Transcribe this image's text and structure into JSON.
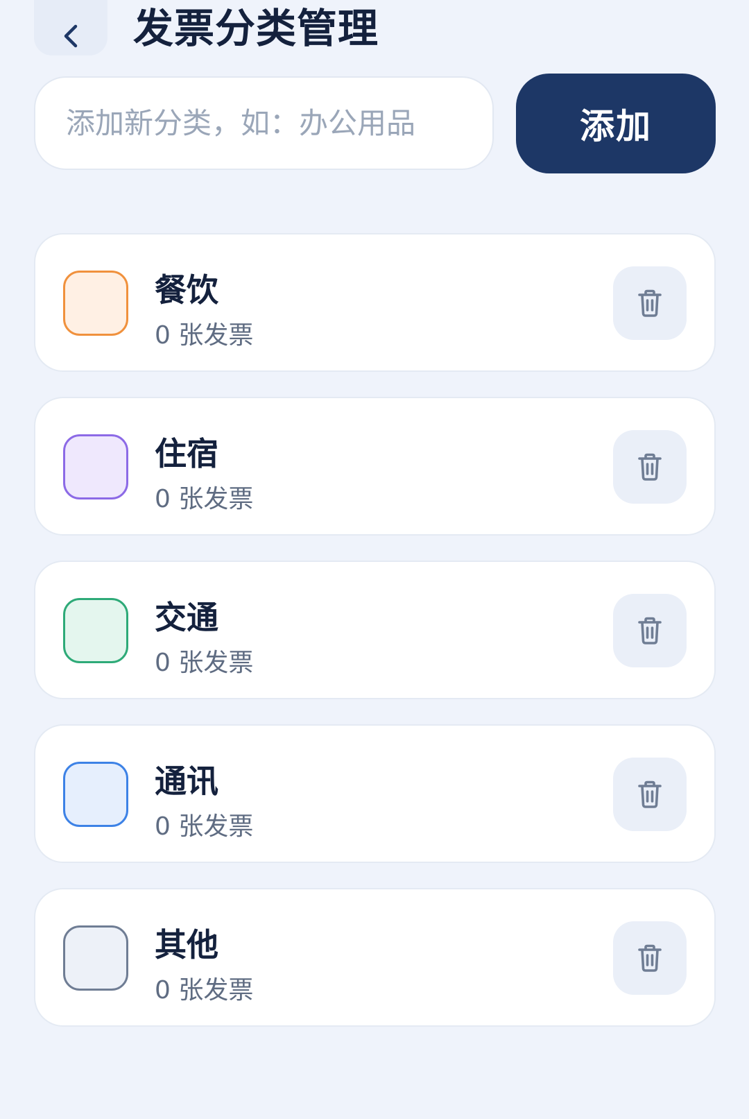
{
  "header": {
    "title": "发票分类管理",
    "back_icon": "chevron-left-icon"
  },
  "add_form": {
    "placeholder": "添加新分类，如：办公用品",
    "value": "",
    "button_label": "添加"
  },
  "categories": [
    {
      "name": "餐饮",
      "count_label": "0 张发票",
      "border": "#f0913d",
      "fill": "#fff0e4"
    },
    {
      "name": "住宿",
      "count_label": "0 张发票",
      "border": "#8c6ae6",
      "fill": "#efe8fd"
    },
    {
      "name": "交通",
      "count_label": "0 张发票",
      "border": "#2eaa78",
      "fill": "#e4f6ee"
    },
    {
      "name": "通讯",
      "count_label": "0 张发票",
      "border": "#3d82e6",
      "fill": "#e6effd"
    },
    {
      "name": "其他",
      "count_label": "0 张发票",
      "border": "#6f7d94",
      "fill": "#edf1f8"
    }
  ],
  "icons": {
    "delete": "trash-icon"
  },
  "colors": {
    "background": "#eff3fb",
    "accent": "#1d3766",
    "title": "#14213d"
  }
}
